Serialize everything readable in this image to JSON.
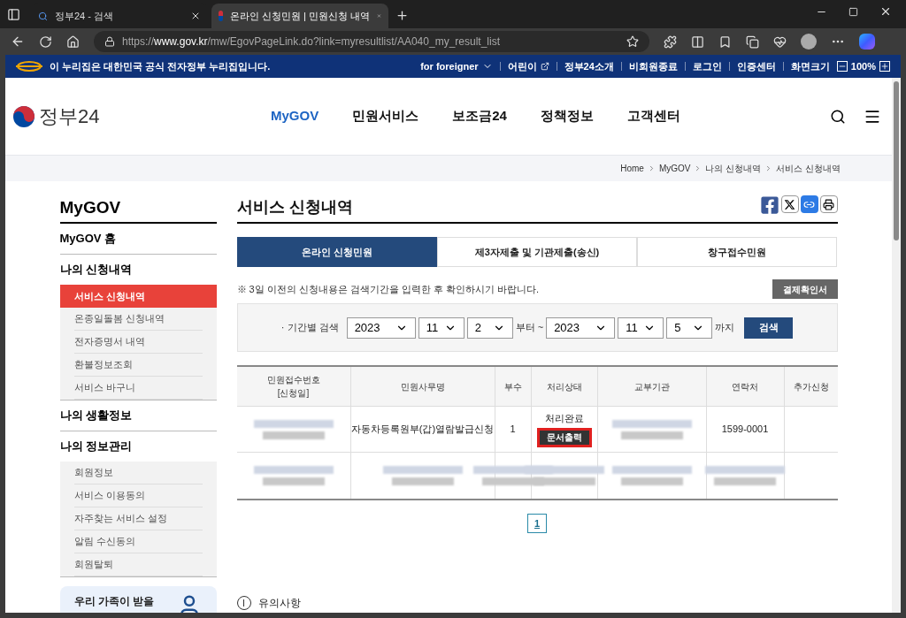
{
  "browser": {
    "tabs": [
      {
        "title": "정부24 - 검색",
        "selected": false
      },
      {
        "title": "온라인 신청민원 | 민원신청 내역",
        "selected": true
      }
    ],
    "url": "https://**www.gov.kr**/mw/EgovPageLink.do?link=myresultlist/AA040_my_result_list"
  },
  "banner": {
    "notice": "이 누리집은 대한민국 공식 전자정부 누리집입니다.",
    "language": "for foreigner",
    "links": [
      "어린이",
      "정부24소개",
      "비회원종료",
      "로그인",
      "인증센터"
    ],
    "zoom_label": "화면크기",
    "zoom": "100%"
  },
  "header": {
    "logo": "정부24",
    "nav": [
      {
        "label": "MyGOV",
        "selected": true
      },
      {
        "label": "민원서비스",
        "selected": false
      },
      {
        "label": "보조금24",
        "selected": false
      },
      {
        "label": "정책정보",
        "selected": false
      },
      {
        "label": "고객센터",
        "selected": false
      }
    ]
  },
  "breadcrumb": [
    "Home",
    "MyGOV",
    "나의 신청내역",
    "서비스 신청내역"
  ],
  "sidebar": {
    "title": "MyGOV",
    "sections": [
      {
        "label": "MyGOV 홈"
      },
      {
        "label": "나의 신청내역",
        "children": [
          {
            "label": "서비스 신청내역",
            "selected": true
          },
          {
            "label": "온종일돌봄 신청내역",
            "selected": false
          },
          {
            "label": "전자증명서 내역",
            "selected": false
          },
          {
            "label": "환불정보조회",
            "selected": false
          },
          {
            "label": "서비스 바구니",
            "selected": false
          }
        ]
      },
      {
        "label": "나의 생활정보"
      },
      {
        "label": "나의 정보관리",
        "children": [
          {
            "label": "회원정보",
            "selected": false
          },
          {
            "label": "서비스 이용동의",
            "selected": false
          },
          {
            "label": "자주찾는 서비스 설정",
            "selected": false
          },
          {
            "label": "알림 수신동의",
            "selected": false
          },
          {
            "label": "회원탈퇴",
            "selected": false
          }
        ]
      }
    ],
    "promo": "우리 가족이 받을"
  },
  "page_title": "서비스 신청내역",
  "tabs": [
    {
      "label": "온라인 신청민원",
      "selected": true
    },
    {
      "label": "제3자제출 및 기관제출(송신)",
      "selected": false
    },
    {
      "label": "창구접수민원",
      "selected": false
    }
  ],
  "notice": "※ 3일 이전의 신청내용은 검색기간을 입력한 후 확인하시기 바랍니다.",
  "receipt_button": "결제확인서",
  "search": {
    "label": "· 기간별 검색",
    "from": [
      "2023",
      "11",
      "2"
    ],
    "from_suffix": "부터 ~",
    "to": [
      "2023",
      "11",
      "5"
    ],
    "to_suffix": "까지",
    "button": "검색"
  },
  "table": {
    "columns": [
      "민원접수번호\n[신청일]",
      "민원사무명",
      "부수",
      "처리상태",
      "교부기관",
      "연락처",
      "추가신청"
    ],
    "rows": [
      {
        "cells": [
          {
            "kind": "blurred"
          },
          {
            "kind": "text",
            "text": "자동차등록원부(갑)열람발급신청"
          },
          {
            "kind": "text",
            "text": "1"
          },
          {
            "kind": "status",
            "text": "처리완료",
            "button": "문서출력",
            "highlighted": true
          },
          {
            "kind": "blurred"
          },
          {
            "kind": "text",
            "text": "1599-0001"
          },
          {
            "kind": "empty"
          }
        ]
      },
      {
        "cells": [
          {
            "kind": "blurred"
          },
          {
            "kind": "blurred"
          },
          {
            "kind": "blurred"
          },
          {
            "kind": "blurred"
          },
          {
            "kind": "blurred"
          },
          {
            "kind": "blurred"
          },
          {
            "kind": "empty"
          }
        ]
      }
    ]
  },
  "pagination": [
    {
      "label": "1",
      "selected": true
    }
  ],
  "footer_heading": "유의사항"
}
